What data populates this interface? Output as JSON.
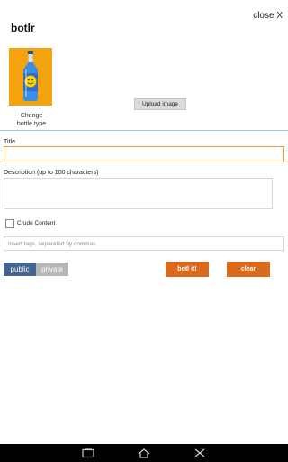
{
  "header": {
    "close_label": "close X",
    "app_title": "botlr"
  },
  "bottle": {
    "caption": "Change\nbottle type",
    "background_color": "#f4a30e"
  },
  "upload": {
    "label": "Upload image"
  },
  "form": {
    "title_label": "Title",
    "title_value": "",
    "description_label": "Description (up to 100 characters)",
    "description_value": "",
    "crude_label": "Crude Content",
    "crude_checked": false,
    "tags_placeholder": "insert tags, separated by commas"
  },
  "visibility": {
    "public_label": "public",
    "private_label": "private",
    "selected": "public"
  },
  "actions": {
    "botl_label": "botl it!",
    "clear_label": "clear"
  },
  "colors": {
    "accent_orange": "#dc6a1d",
    "public_blue": "#44658e",
    "divider_blue": "#9bc7e6",
    "focus_orange": "#f19a37"
  },
  "navbar": {
    "icons": [
      "recent-apps-icon",
      "home-icon",
      "back-icon"
    ]
  }
}
